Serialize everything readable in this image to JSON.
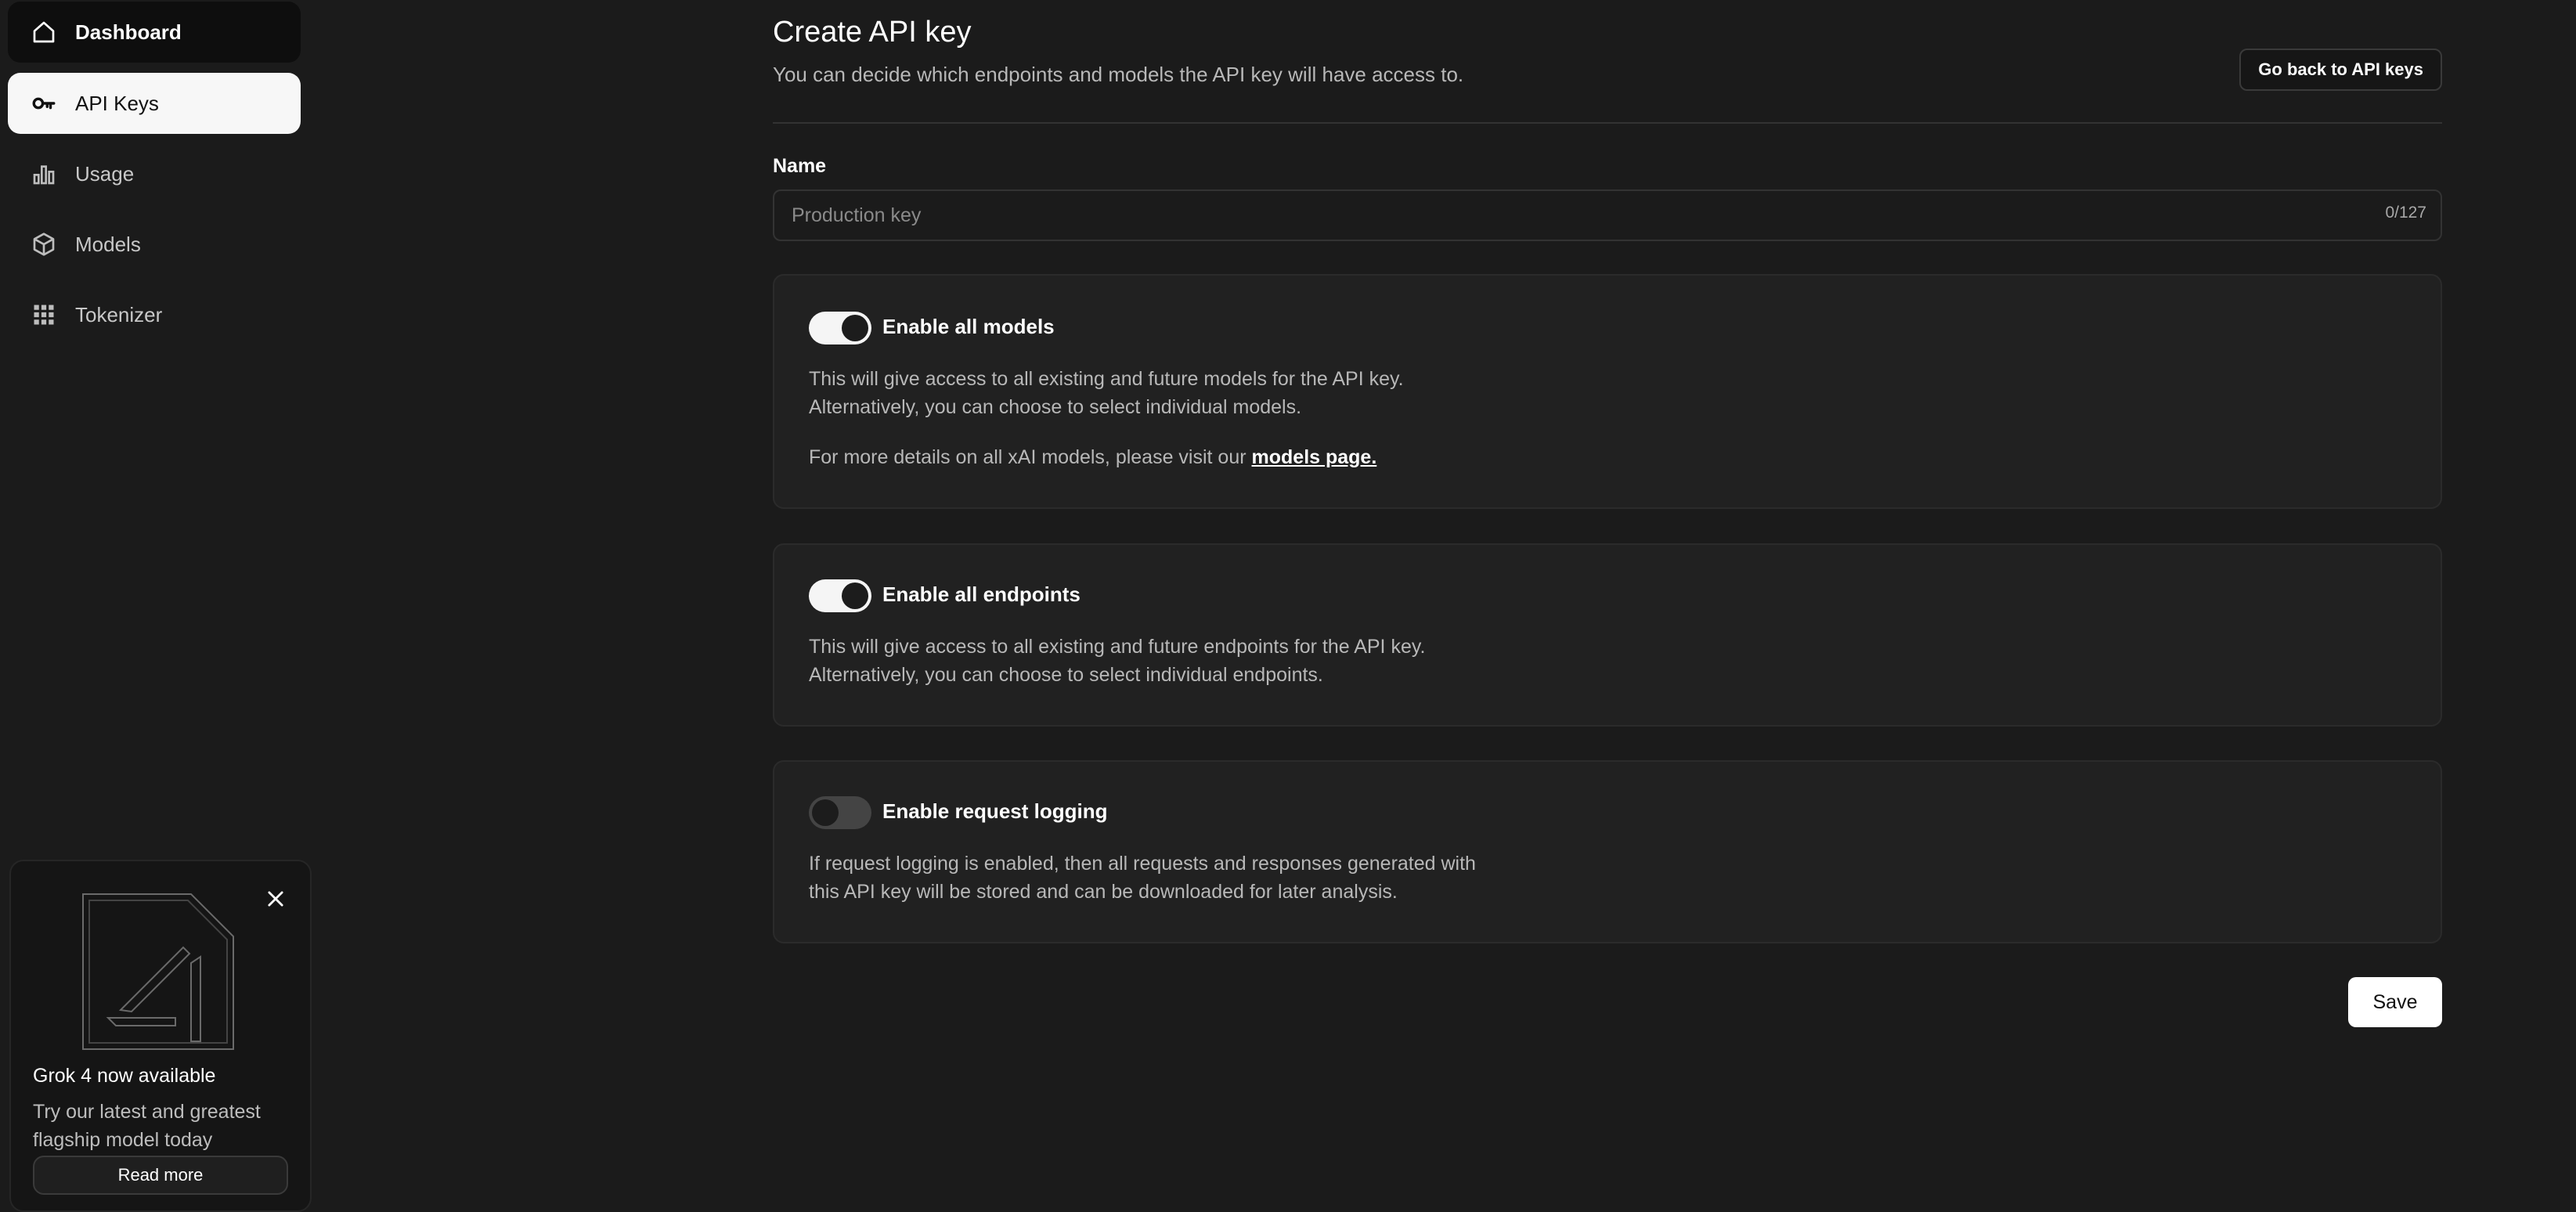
{
  "sidebar": {
    "items": [
      {
        "label": "Dashboard",
        "icon": "home-icon"
      },
      {
        "label": "API Keys",
        "icon": "key-icon"
      },
      {
        "label": "Usage",
        "icon": "bar-chart-icon"
      },
      {
        "label": "Models",
        "icon": "cube-icon"
      },
      {
        "label": "Tokenizer",
        "icon": "grid-icon"
      }
    ],
    "active": "API Keys"
  },
  "promo": {
    "title": "Grok 4 now available",
    "description": "Try our latest and greatest flagship model today",
    "button": "Read more"
  },
  "header": {
    "title": "Create API key",
    "subtitle": "You can decide which endpoints and models the API key will have access to.",
    "back_button": "Go back to API keys"
  },
  "name_field": {
    "label": "Name",
    "placeholder": "Production key",
    "counter": "0/127"
  },
  "cards": {
    "models": {
      "title": "Enable all models",
      "enabled": true,
      "line1": "This will give access to all existing and future models for the API key.",
      "line2": "Alternatively, you can choose to select individual models.",
      "line3_prefix": "For more details on all xAI models, please visit our ",
      "link": "models page."
    },
    "endpoints": {
      "title": "Enable all endpoints",
      "enabled": true,
      "line1": "This will give access to all existing and future endpoints for the API key.",
      "line2": "Alternatively, you can choose to select individual endpoints."
    },
    "logging": {
      "title": "Enable request logging",
      "enabled": false,
      "line1": "If request logging is enabled, then all requests and responses generated with",
      "line2": "this API key will be stored and can be downloaded for later analysis."
    }
  },
  "save_button": "Save"
}
